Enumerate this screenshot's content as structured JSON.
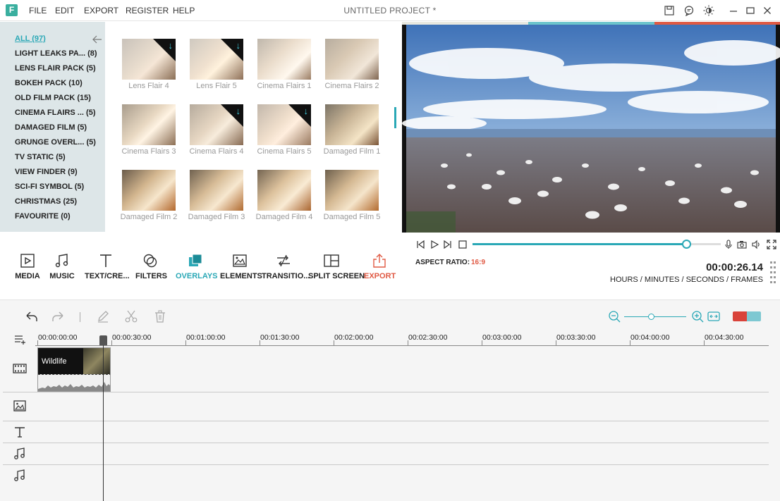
{
  "window": {
    "menu": [
      "FILE",
      "EDIT",
      "EXPORT",
      "REGISTER",
      "HELP"
    ],
    "project_title": "UNTITLED PROJECT *",
    "logo_letter": "F"
  },
  "library": {
    "categories": [
      {
        "label": "ALL (97)",
        "active": true
      },
      {
        "label": "LIGHT LEAKS PA...  (8)"
      },
      {
        "label": "LENS FLAIR PACK (5)"
      },
      {
        "label": "BOKEH PACK (10)"
      },
      {
        "label": "OLD FILM PACK (15)"
      },
      {
        "label": "CINEMA FLAIRS ...  (5)"
      },
      {
        "label": "DAMAGED FILM (5)"
      },
      {
        "label": "GRUNGE OVERL...  (5)"
      },
      {
        "label": "TV STATIC (5)"
      },
      {
        "label": "VIEW FINDER (9)"
      },
      {
        "label": "SCI-FI SYMBOL (5)"
      },
      {
        "label": "CHRISTMAS (25)"
      },
      {
        "label": "FAVOURITE (0)"
      }
    ],
    "items": [
      {
        "label": "Lens Flair 4",
        "download": true
      },
      {
        "label": "Lens Flair 5",
        "download": true
      },
      {
        "label": "Cinema Flairs 1",
        "download": false
      },
      {
        "label": "Cinema Flairs 2",
        "download": false
      },
      {
        "label": "Cinema Flairs 3",
        "download": false
      },
      {
        "label": "Cinema Flairs 4",
        "download": true
      },
      {
        "label": "Cinema Flairs 5",
        "download": true
      },
      {
        "label": "Damaged Film 1",
        "download": false
      },
      {
        "label": "Damaged Film 2",
        "download": false
      },
      {
        "label": "Damaged Film 3",
        "download": false
      },
      {
        "label": "Damaged Film 4",
        "download": false
      },
      {
        "label": "Damaged Film 5",
        "download": false
      }
    ]
  },
  "tools": {
    "media": "MEDIA",
    "music": "MUSIC",
    "text": "TEXT/CRE...",
    "filters": "FILTERS",
    "overlays": "OVERLAYS",
    "elements": "ELEMENTS",
    "transitions": "TRANSITIO...",
    "split_screen": "SPLIT SCREEN",
    "export": "EXPORT"
  },
  "player": {
    "aspect_label": "ASPECT RATIO:",
    "aspect_value": "16:9",
    "timecode": "00:00:26.14",
    "time_units": "HOURS / MINUTES / SECONDS / FRAMES",
    "progress": 0.86
  },
  "timeline": {
    "ruler_labels": [
      "00:00:00:00",
      "00:00:30:00",
      "00:01:00:00",
      "00:01:30:00",
      "00:02:00:00",
      "00:02:30:00",
      "00:03:00:00",
      "00:03:30:00",
      "00:04:00:00",
      "00:04:30:00"
    ],
    "clip_name": "Wildlife"
  },
  "colors": {
    "accent": "#2aa8b6",
    "export": "#e05a44",
    "sidebar_bg": "#dde6e8"
  }
}
